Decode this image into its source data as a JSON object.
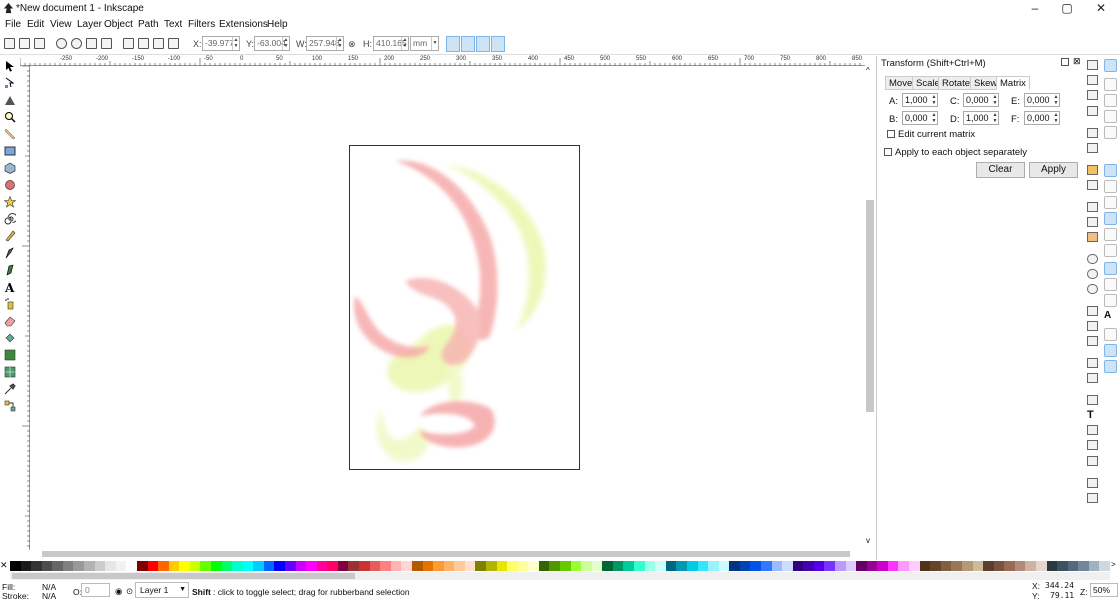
{
  "window": {
    "title": "*New document 1 - Inkscape",
    "minimize": "–",
    "maximize": "▢",
    "close": "✕"
  },
  "menu": [
    "File",
    "Edit",
    "View",
    "Layer",
    "Object",
    "Path",
    "Text",
    "Filters",
    "Extensions",
    "Help"
  ],
  "toolbar": {
    "x_label": "X:",
    "x_value": "-39.977",
    "y_label": "Y:",
    "y_value": "-63.004",
    "w_label": "W:",
    "w_value": "257.948",
    "h_label": "H:",
    "h_value": "410.165",
    "unit": "mm"
  },
  "ruler": {
    "h_labels": [
      "-250",
      "-200",
      "-150",
      "-100",
      "-50",
      "0",
      "50",
      "100",
      "150",
      "200",
      "250",
      "300",
      "350",
      "400",
      "450",
      "500",
      "550",
      "600",
      "650",
      "700",
      "750",
      "800",
      "850"
    ]
  },
  "transform_panel": {
    "title": "Transform (Shift+Ctrl+M)",
    "tabs": [
      "Move",
      "Scale",
      "Rotate",
      "Skew",
      "Matrix"
    ],
    "active_tab": "Matrix",
    "fields": [
      {
        "label": "A:",
        "value": "1,000"
      },
      {
        "label": "C:",
        "value": "0,000"
      },
      {
        "label": "E:",
        "value": "0,000"
      },
      {
        "label": "B:",
        "value": "0,000"
      },
      {
        "label": "D:",
        "value": "1,000"
      },
      {
        "label": "F:",
        "value": "0,000"
      }
    ],
    "edit_current_matrix": "Edit current matrix",
    "apply_separately": "Apply to each object separately",
    "clear_label": "Clear",
    "apply_label": "Apply"
  },
  "palette": {
    "colors": [
      "#000000",
      "#1a1a1a",
      "#333333",
      "#4d4d4d",
      "#666666",
      "#808080",
      "#999999",
      "#b3b3b3",
      "#cccccc",
      "#e6e6e6",
      "#f2f2f2",
      "#ffffff",
      "#800000",
      "#ff0000",
      "#ff6600",
      "#ffcc00",
      "#ffff00",
      "#ccff00",
      "#66ff00",
      "#00ff00",
      "#00ff66",
      "#00ffcc",
      "#00ffff",
      "#00ccff",
      "#0066ff",
      "#0000ff",
      "#6600ff",
      "#cc00ff",
      "#ff00ff",
      "#ff0099",
      "#ff0066",
      "#800040",
      "#993333",
      "#cc3333",
      "#e65c5c",
      "#ff8080",
      "#ffb3b3",
      "#ffd5d5",
      "#b35900",
      "#e67300",
      "#ff9933",
      "#ffb366",
      "#ffcc99",
      "#ffe0cc",
      "#808000",
      "#b3b300",
      "#e6e600",
      "#ffff66",
      "#ffff99",
      "#ffffcc",
      "#336600",
      "#4d9900",
      "#66cc00",
      "#99ff33",
      "#ccff99",
      "#e5ffcc",
      "#006633",
      "#009966",
      "#00cc99",
      "#33ffcc",
      "#99ffe6",
      "#ccfff5",
      "#006680",
      "#0099b3",
      "#00cce6",
      "#33e6ff",
      "#99f2ff",
      "#ccf9ff",
      "#003380",
      "#0044b3",
      "#0055e6",
      "#3377ff",
      "#99bbff",
      "#ccddff",
      "#330080",
      "#4400b3",
      "#5500e6",
      "#7733ff",
      "#bb99ff",
      "#ddccff",
      "#660066",
      "#990099",
      "#cc00cc",
      "#ff33ff",
      "#ff99ff",
      "#ffccff",
      "#4d3319",
      "#66442a",
      "#806040",
      "#997755",
      "#b39977",
      "#ccbb99",
      "#5c3d2e",
      "#7a5240",
      "#996b55",
      "#b38a77",
      "#ccb3a3",
      "#e6d5cc",
      "#2b3a42",
      "#3d5160",
      "#52697d",
      "#6f8799",
      "#9fb1bf",
      "#cfd8df"
    ]
  },
  "status": {
    "fill_label": "Fill:",
    "fill_value": "N/A",
    "stroke_label": "Stroke:",
    "stroke_value": "N/A",
    "opacity_label": "O:",
    "opacity_value": "0",
    "layer": "Layer 1",
    "hint_key": "Shift",
    "hint_text": ": click to toggle select; drag for rubberband selection",
    "cursor_x_label": "X:",
    "cursor_x": "344.24",
    "cursor_y_label": "Y:",
    "cursor_y": "79.11",
    "zoom_label": "Z:",
    "zoom": "50%"
  },
  "colors": {
    "accent": "#7eb4ea",
    "page_border": "#333333"
  }
}
